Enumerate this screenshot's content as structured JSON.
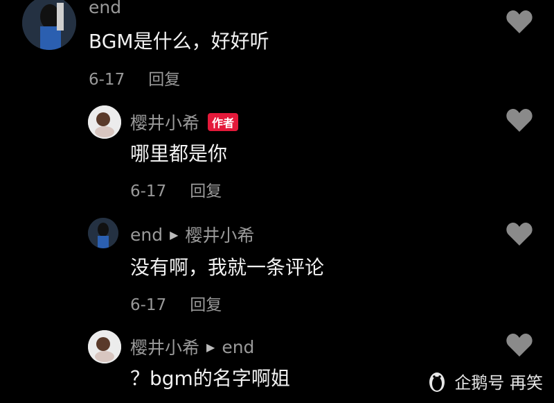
{
  "colors": {
    "background": "#000000",
    "author_badge": "#e4193a",
    "heart": "#8a8a8a",
    "secondary_text": "#9a9a9a"
  },
  "comments": [
    {
      "user": "end",
      "text": "BGM是什么，好好听",
      "date": "6-17",
      "reply_label": "回复"
    },
    {
      "user": "樱井小希",
      "badge": "作者",
      "text": "哪里都是你",
      "date": "6-17",
      "reply_label": "回复"
    },
    {
      "user": "end",
      "reply_to": "樱井小希",
      "text": "没有啊，我就一条评论",
      "date": "6-17",
      "reply_label": "回复"
    },
    {
      "user": "樱井小希",
      "reply_to": "end",
      "text": "？bgm的名字啊姐"
    }
  ],
  "watermark": {
    "text": "企鹅号 再笑",
    "icon": "penguin-icon"
  },
  "icons": {
    "like": "heart-icon",
    "reply_arrow": "play-arrow-icon"
  }
}
